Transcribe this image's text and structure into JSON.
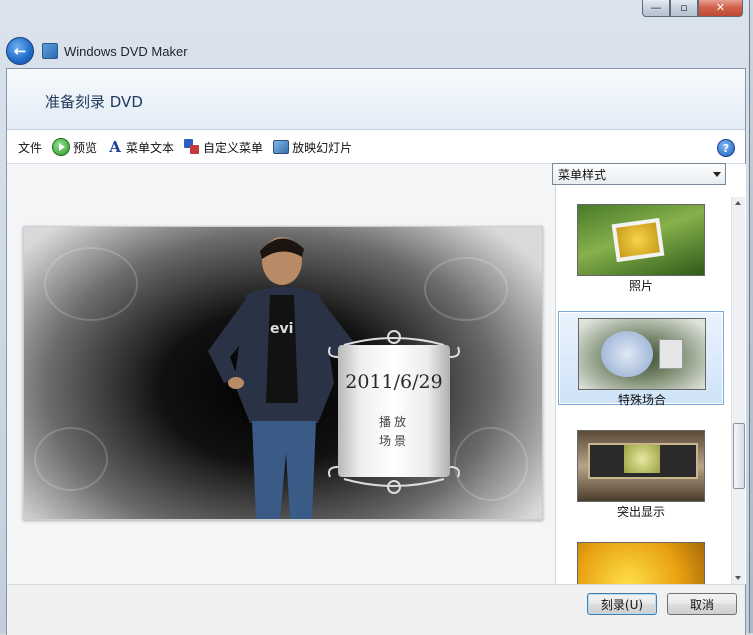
{
  "window": {
    "app_title": "Windows DVD Maker",
    "page_title": "准备刻录 DVD",
    "caption_min": "—",
    "caption_max": "▫",
    "caption_close": "✕"
  },
  "toolbar": {
    "file": "文件",
    "preview": "预览",
    "menu_text": "菜单文本",
    "customize_menu": "自定义菜单",
    "slideshow": "放映幻灯片",
    "help": "?"
  },
  "preview": {
    "date": "2011/6/29",
    "play_label": "播放",
    "scenes_label": "场景"
  },
  "side_panel": {
    "select_value": "菜单样式",
    "styles": [
      {
        "label": "照片",
        "selected": false
      },
      {
        "label": "特殊场合",
        "selected": true
      },
      {
        "label": "突出显示",
        "selected": false
      },
      {
        "label": "",
        "selected": false
      }
    ]
  },
  "footer": {
    "burn_label": "刻录(U)",
    "cancel_label": "取消"
  },
  "colors": {
    "accent": "#1e3a5f",
    "selection": "#cfe3f8"
  }
}
